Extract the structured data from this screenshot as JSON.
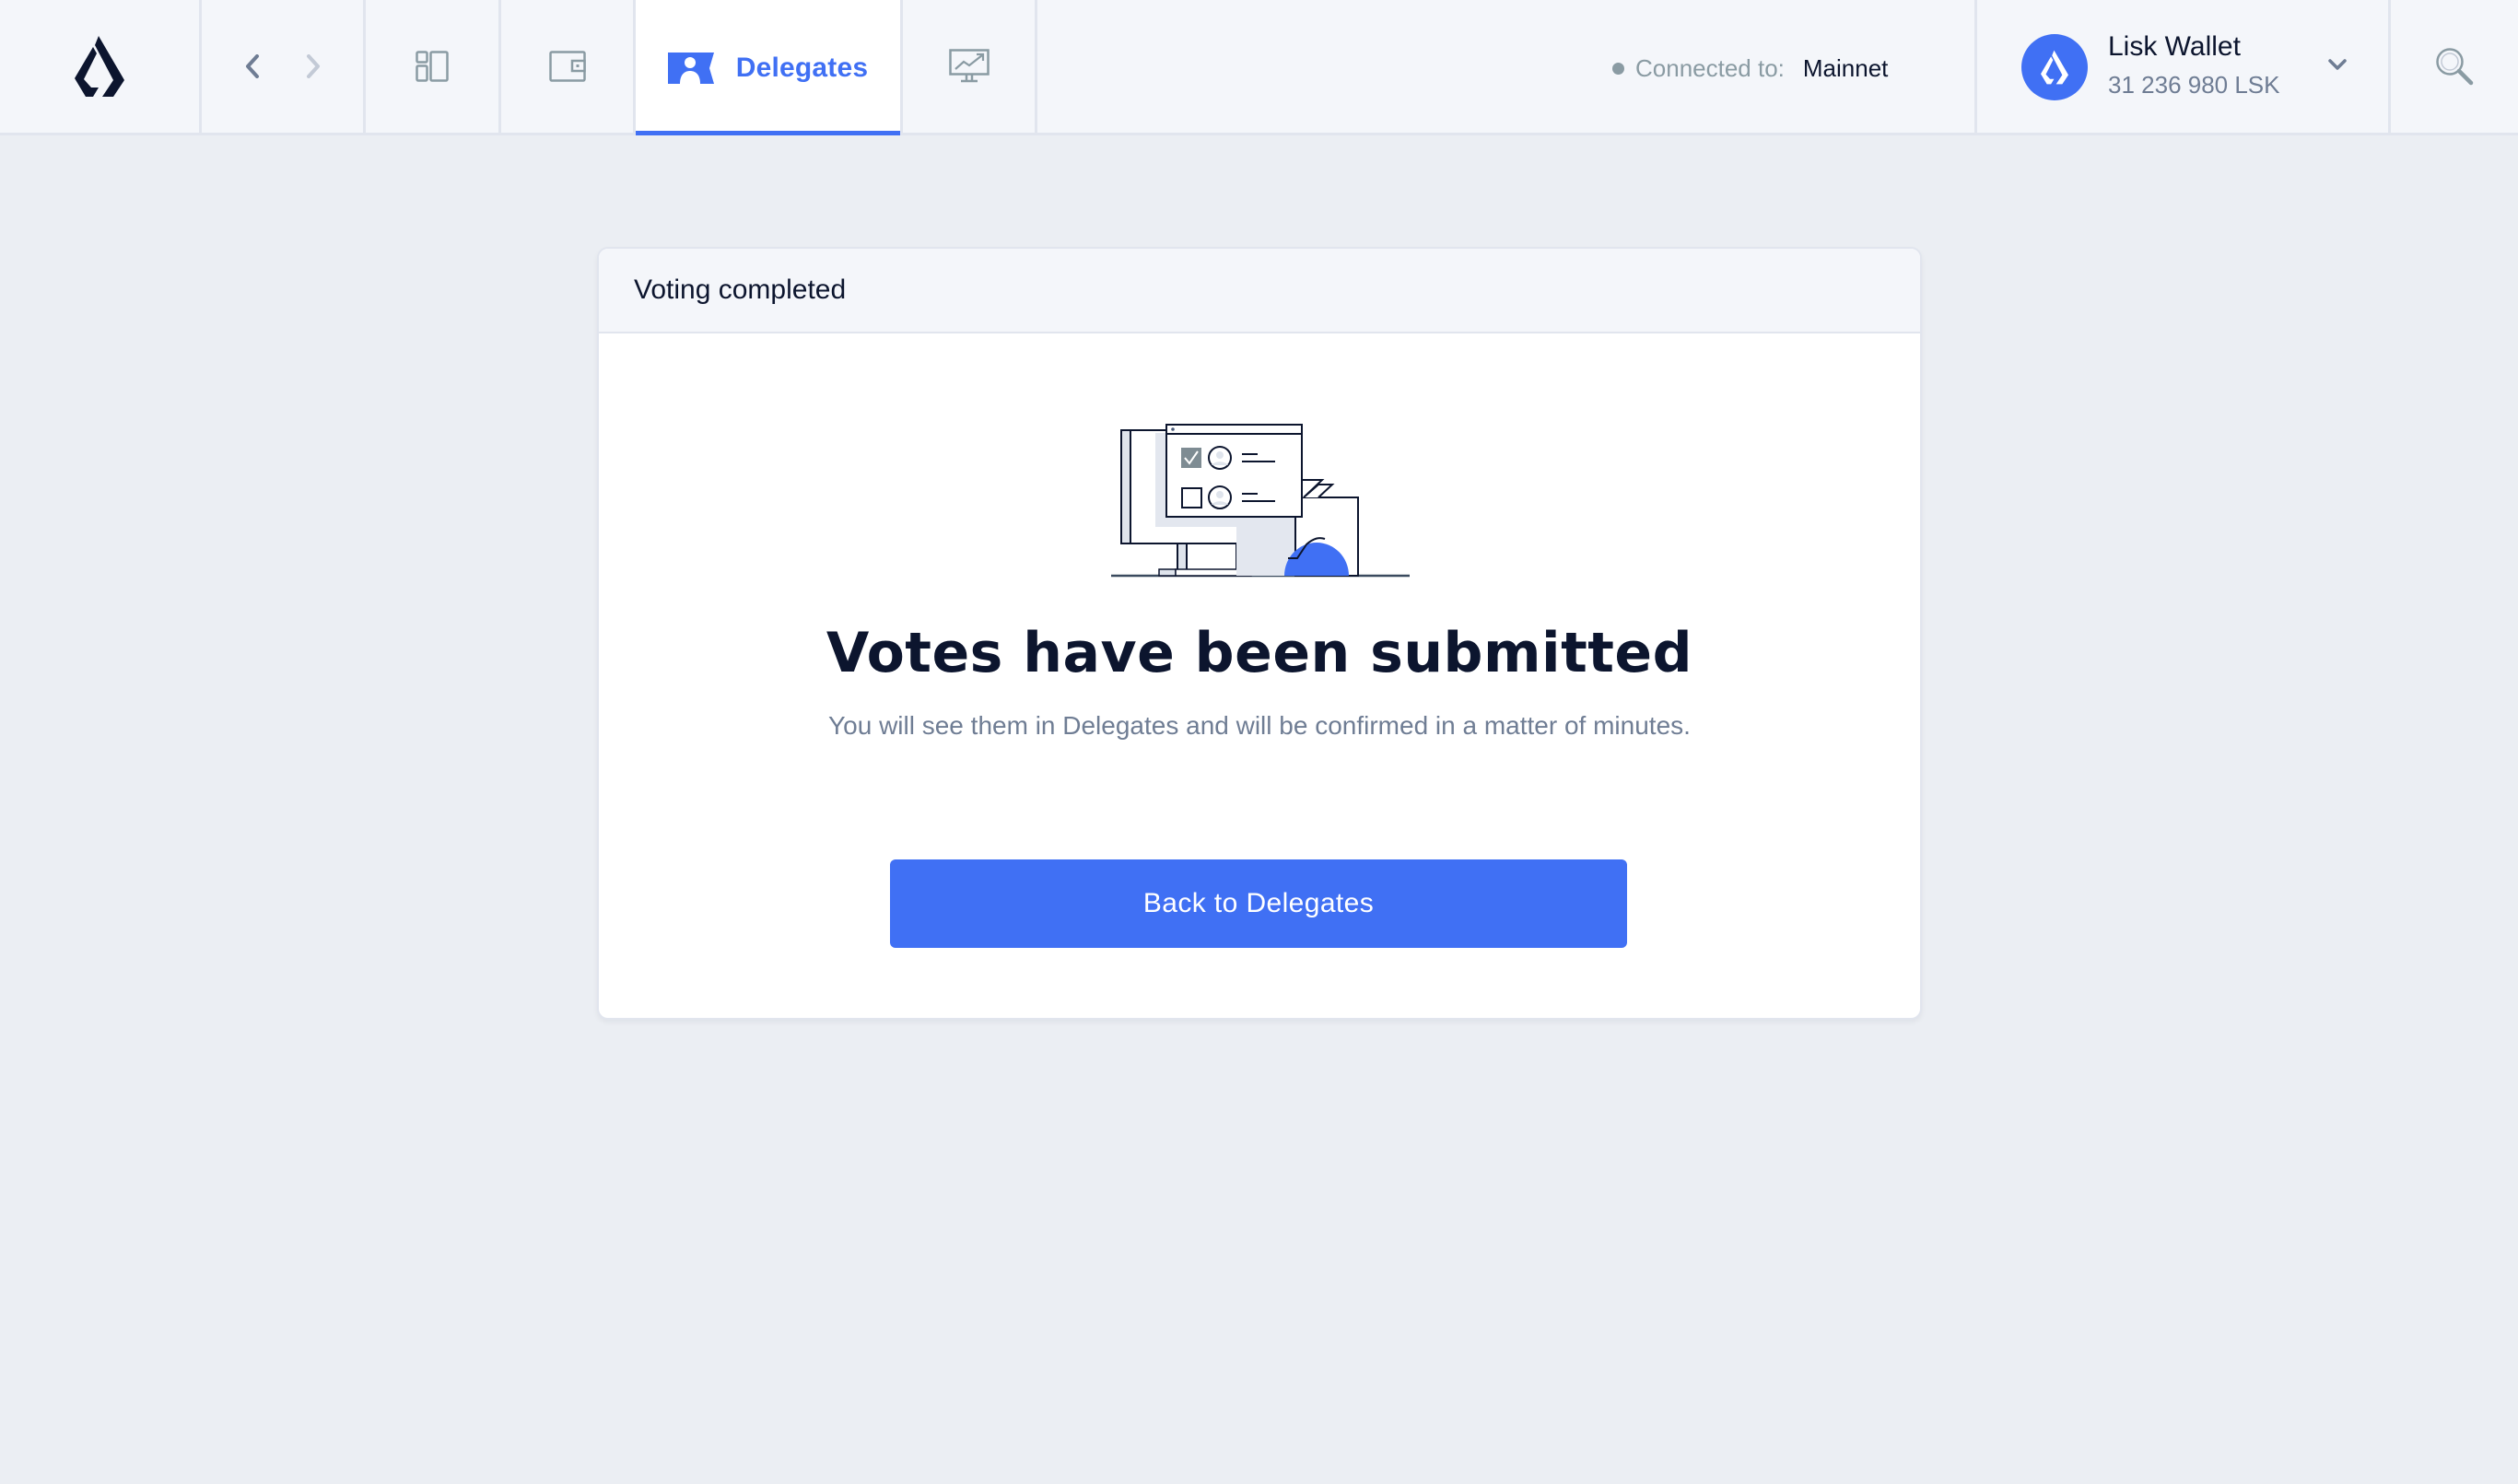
{
  "topbar": {
    "logo": "lisk-logo",
    "nav": {
      "back_icon": "chevron-left-icon",
      "forward_icon": "chevron-right-icon"
    },
    "tabs": [
      {
        "id": "dashboard",
        "icon": "dashboard-icon",
        "label": ""
      },
      {
        "id": "wallet",
        "icon": "wallet-icon",
        "label": ""
      },
      {
        "id": "delegates",
        "icon": "delegates-icon",
        "label": "Delegates",
        "active": true
      },
      {
        "id": "monitor",
        "icon": "monitor-chart-icon",
        "label": ""
      }
    ],
    "connection": {
      "label": "Connected to:",
      "network": "Mainnet",
      "status_color": "#8a9ba3"
    },
    "account": {
      "name": "Lisk Wallet",
      "balance": "31 236 980 LSK",
      "avatar_color": "#4070f4"
    },
    "search_icon": "search-icon"
  },
  "card": {
    "header_title": "Voting completed",
    "illustration": "voting-computer-illustration",
    "title": "Votes have been submitted",
    "subtitle": "You will see them in Delegates and will be confirmed in a matter of minutes.",
    "button_label": "Back to Delegates"
  },
  "colors": {
    "accent": "#4070f4",
    "text_primary": "#0c152e",
    "text_secondary": "#6f7d94",
    "background": "#ebeef3"
  }
}
